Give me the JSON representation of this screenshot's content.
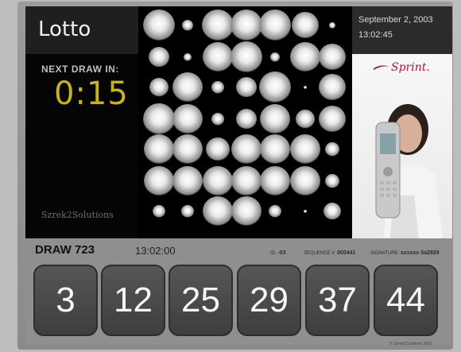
{
  "header": {
    "title": "Lotto",
    "date": "September 2, 2003",
    "time": "13:02:45"
  },
  "countdown": {
    "label": "NEXT DRAW IN:",
    "value": "0:15"
  },
  "branding": {
    "logo": "Szrek2Solutions",
    "ad_brand": "Sprint."
  },
  "draw": {
    "label": "DRAW 723",
    "time": "13:02:00",
    "meta": [
      {
        "label": "ID:",
        "value": "-03"
      },
      {
        "label": "SEQUENCE #:",
        "value": "000441"
      },
      {
        "label": "SIGNATURE:",
        "value": "xxxxxx 5a2929"
      }
    ],
    "numbers": [
      "3",
      "12",
      "25",
      "29",
      "37",
      "44"
    ]
  },
  "footer": {
    "copyright": "© Szrek2Solutions 2003"
  },
  "colors": {
    "countdown": "#c7b21f",
    "sprint_red": "#b0143a"
  }
}
